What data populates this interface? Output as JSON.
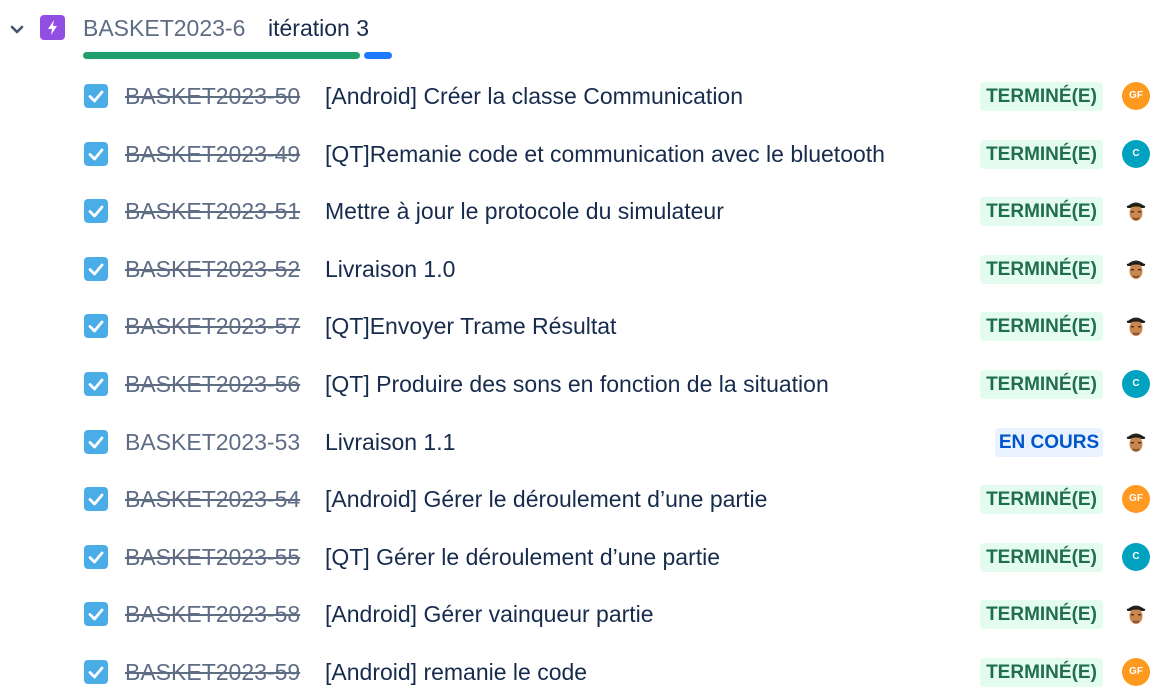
{
  "epic": {
    "key": "BASKET2023-6",
    "name": "itération 3",
    "icon": "lightning-icon",
    "progress": {
      "done_fraction": 0.9,
      "in_progress_fraction": 0.1
    },
    "colors": {
      "epic_icon": "#904ee2",
      "done": "#22a06b",
      "in_progress": "#1d7afc"
    }
  },
  "issues": [
    {
      "key": "BASKET2023-50",
      "summary": "[Android] Créer la classe Communication",
      "status": "TERMINÉ(E)",
      "status_type": "done",
      "assignee": "GF",
      "assignee_type": "gf"
    },
    {
      "key": "BASKET2023-49",
      "summary": "[QT]Remanie code et communication avec le bluetooth",
      "status": "TERMINÉ(E)",
      "status_type": "done",
      "assignee": "C",
      "assignee_type": "c"
    },
    {
      "key": "BASKET2023-51",
      "summary": "Mettre à jour le protocole du simulateur",
      "status": "TERMINÉ(E)",
      "status_type": "done",
      "assignee": "",
      "assignee_type": "photo"
    },
    {
      "key": "BASKET2023-52",
      "summary": "Livraison 1.0",
      "status": "TERMINÉ(E)",
      "status_type": "done",
      "assignee": "",
      "assignee_type": "photo"
    },
    {
      "key": "BASKET2023-57",
      "summary": "[QT]Envoyer Trame Résultat",
      "status": "TERMINÉ(E)",
      "status_type": "done",
      "assignee": "",
      "assignee_type": "photo"
    },
    {
      "key": "BASKET2023-56",
      "summary": "[QT] Produire des sons en fonction de la situation",
      "status": "TERMINÉ(E)",
      "status_type": "done",
      "assignee": "C",
      "assignee_type": "c"
    },
    {
      "key": "BASKET2023-53",
      "summary": "Livraison 1.1",
      "status": "EN COURS",
      "status_type": "inprog",
      "assignee": "",
      "assignee_type": "photo"
    },
    {
      "key": "BASKET2023-54",
      "summary": "[Android] Gérer le déroulement d’une partie",
      "status": "TERMINÉ(E)",
      "status_type": "done",
      "assignee": "GF",
      "assignee_type": "gf"
    },
    {
      "key": "BASKET2023-55",
      "summary": "[QT] Gérer le déroulement d’une partie",
      "status": "TERMINÉ(E)",
      "status_type": "done",
      "assignee": "C",
      "assignee_type": "c"
    },
    {
      "key": "BASKET2023-58",
      "summary": "[Android] Gérer vainqueur partie",
      "status": "TERMINÉ(E)",
      "status_type": "done",
      "assignee": "",
      "assignee_type": "photo"
    },
    {
      "key": "BASKET2023-59",
      "summary": "[Android] remanie le code",
      "status": "TERMINÉ(E)",
      "status_type": "done",
      "assignee": "GF",
      "assignee_type": "gf"
    }
  ],
  "colors": {
    "checkbox": "#4bade8",
    "done_status_bg": "#e3fcef",
    "done_status_text": "#216e4e",
    "inprog_status_bg": "#e9f2ff",
    "inprog_status_text": "#0055cc",
    "avatar_gf": "#ff991f",
    "avatar_c": "#00a3bf"
  }
}
